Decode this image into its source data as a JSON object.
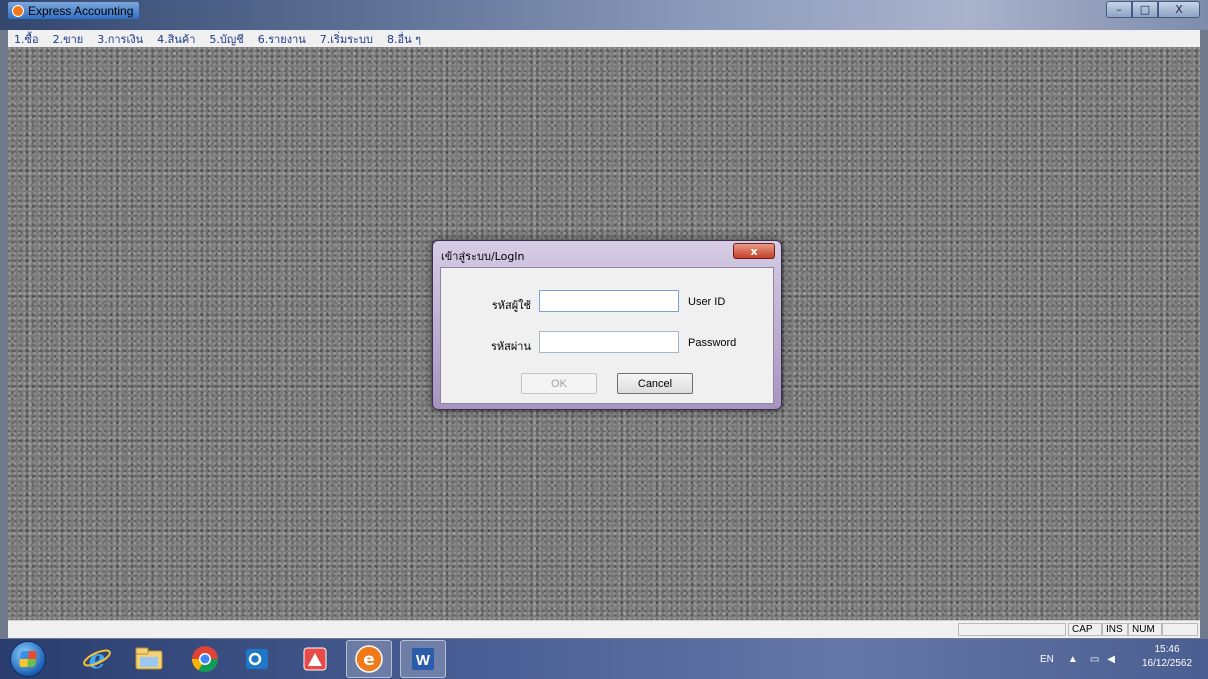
{
  "window": {
    "title": "Express Accounting",
    "controls": {
      "minimize": "–",
      "maximize": "□",
      "close": "X"
    }
  },
  "menu": [
    {
      "label": "1.ซื้อ"
    },
    {
      "label": "2.ขาย"
    },
    {
      "label": "3.การเงิน"
    },
    {
      "label": "4.สินค้า"
    },
    {
      "label": "5.บัญชี"
    },
    {
      "label": "6.รายงาน"
    },
    {
      "label": "7.เริ่มระบบ"
    },
    {
      "label": "8.อื่น ๆ"
    }
  ],
  "login": {
    "title": "เข้าสู่ระบบ/LogIn",
    "close_label": "x",
    "user_label_th": "รหัสผู้ใช้",
    "user_label_en": "User ID",
    "user_value": "",
    "password_label_th": "รหัสผ่าน",
    "password_label_en": "Password",
    "password_value": "",
    "ok_label": "OK",
    "cancel_label": "Cancel"
  },
  "status": {
    "cap": "CAP",
    "ins": "INS",
    "num": "NUM"
  },
  "taskbar": {
    "apps": [
      "internet-explorer-icon",
      "file-explorer-icon",
      "chrome-icon",
      "outlook-icon",
      "express-icon-2",
      "express-accounting-icon",
      "word-icon"
    ],
    "language": "EN",
    "time": "15:46",
    "date": "16/12/2562"
  },
  "colors": {
    "menu_text": "#1f3a8a",
    "dialog_frame": "#a694c0",
    "taskbar": "#4a5f95"
  }
}
